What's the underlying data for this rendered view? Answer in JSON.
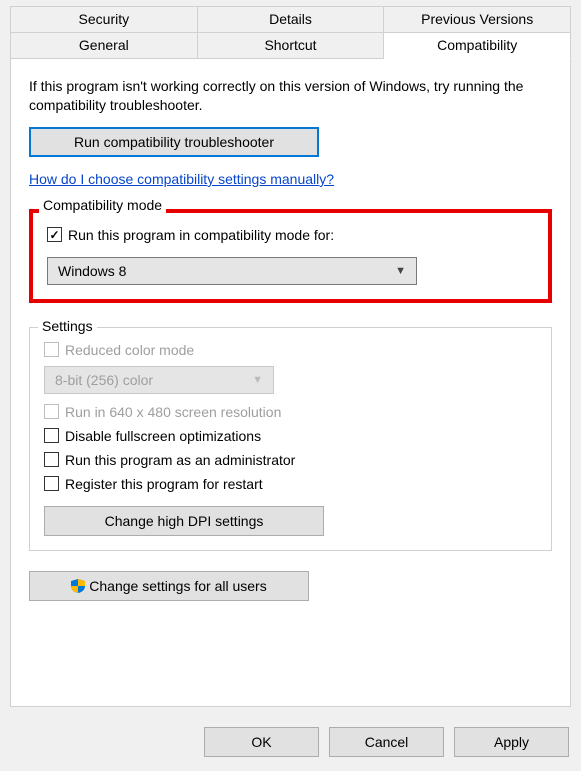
{
  "tabs": {
    "row1": [
      "Security",
      "Details",
      "Previous Versions"
    ],
    "row2": [
      "General",
      "Shortcut",
      "Compatibility"
    ]
  },
  "intro": "If this program isn't working correctly on this version of Windows, try running the compatibility troubleshooter.",
  "buttons": {
    "troubleshooter": "Run compatibility troubleshooter",
    "dpi": "Change high DPI settings",
    "all_users": "Change settings for all users",
    "ok": "OK",
    "cancel": "Cancel",
    "apply": "Apply"
  },
  "link": "How do I choose compatibility settings manually?",
  "groups": {
    "compat_mode": "Compatibility mode",
    "settings": "Settings"
  },
  "compat": {
    "checkbox_label": "Run this program in compatibility mode for:",
    "selected": "Windows 8"
  },
  "settings": {
    "reduced_color": "Reduced color mode",
    "color_selected": "8-bit (256) color",
    "run_640": "Run in 640 x 480 screen resolution",
    "disable_fullscreen": "Disable fullscreen optimizations",
    "run_admin": "Run this program as an administrator",
    "register_restart": "Register this program for restart"
  }
}
